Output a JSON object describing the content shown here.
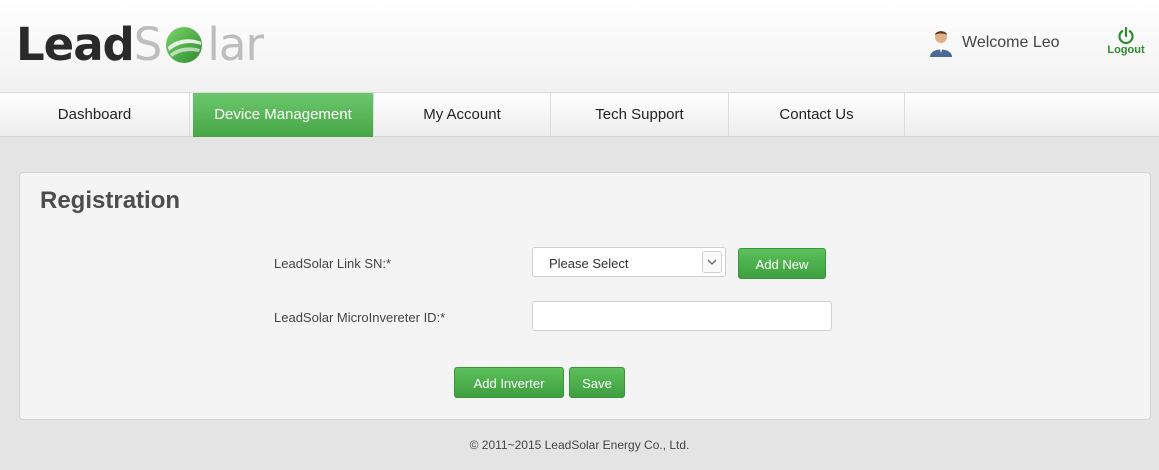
{
  "header": {
    "logo_part1": "Lead",
    "logo_part2_before": "S",
    "logo_part2_after": "lar",
    "welcome_text": "Welcome Leo",
    "logout_label": "Logout",
    "avatar_icon": "user-avatar-icon",
    "logout_icon": "power-icon"
  },
  "nav": {
    "items": [
      {
        "label": "Dashboard"
      },
      {
        "label": "Device Management"
      },
      {
        "label": "My Account"
      },
      {
        "label": "Tech Support"
      },
      {
        "label": "Contact Us"
      }
    ],
    "active_index": 1
  },
  "form": {
    "title": "Registration",
    "link_sn_label": "LeadSolar Link SN:*",
    "link_sn_value": "Please Select",
    "add_new_label": "Add New",
    "micro_id_label": "LeadSolar MicroInvereter ID:*",
    "micro_id_value": "",
    "add_inverter_label": "Add Inverter",
    "save_label": "Save"
  },
  "footer": {
    "copyright": "© 2011~2015 LeadSolar Energy Co., Ltd."
  },
  "colors": {
    "accent_green": "#4caf50",
    "logo_dark": "#2a2a2a",
    "logo_light": "#bdbdbd",
    "panel_bg": "#f4f4f4",
    "page_bg": "#e4e4e4"
  }
}
